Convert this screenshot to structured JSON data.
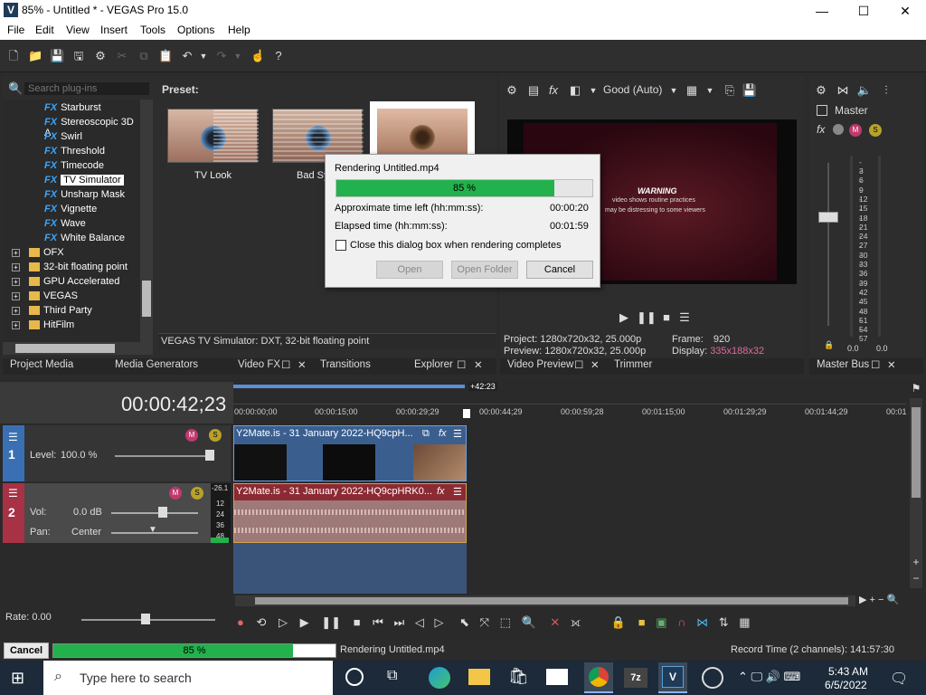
{
  "window": {
    "title": "85% - Untitled * - VEGAS Pro 15.0",
    "logo": "V",
    "min": "—",
    "max": "☐",
    "close": "✕"
  },
  "menu": [
    "File",
    "Edit",
    "View",
    "Insert",
    "Tools",
    "Options",
    "Help"
  ],
  "plugins": {
    "search_placeholder": "Search plug-ins",
    "fx_prefix": "FX",
    "fx_items": [
      "Starburst",
      "Stereoscopic 3D A",
      "Swirl",
      "Threshold",
      "Timecode",
      "TV Simulator",
      "Unsharp Mask",
      "Vignette",
      "Wave",
      "White Balance"
    ],
    "folders": [
      "OFX",
      "32-bit floating point",
      "GPU Accelerated",
      "VEGAS",
      "Third Party",
      "HitFilm"
    ],
    "preset_label": "Preset:",
    "presets": [
      "TV Look",
      "Bad Sy"
    ],
    "status": "VEGAS TV Simulator: DXT, 32-bit floating point"
  },
  "tabs_left": [
    "Project Media",
    "Media Generators",
    "Video FX",
    "Transitions",
    "Explorer"
  ],
  "preview": {
    "quality": "Good (Auto)",
    "warning_title": "WARNING",
    "warning_line1": "video shows routine practices",
    "warning_line2": "may be distressing to some viewers",
    "project_label": "Project:",
    "project_value": "1280x720x32, 25.000p",
    "frame_label": "Frame:",
    "frame_value": "920",
    "preview_label": "Preview:",
    "preview_value": "1280x720x32, 25.000p",
    "display_label": "Display:",
    "display_value": "335x188x32",
    "tabs": [
      "Video Preview",
      "Trimmer"
    ]
  },
  "master": {
    "label": "Master",
    "db_scale": [
      "3",
      "6",
      "9",
      "12",
      "15",
      "18",
      "21",
      "24",
      "27",
      "30",
      "33",
      "36",
      "39",
      "42",
      "45",
      "48",
      "51",
      "54",
      "57"
    ],
    "left_val": "0.0",
    "right_val": "0.0",
    "tab": "Master Bus"
  },
  "dialog": {
    "title": "Rendering Untitled.mp4",
    "progress_text": "85 %",
    "progress": 0.85,
    "time_left_label": "Approximate time left (hh:mm:ss):",
    "time_left_value": "00:00:20",
    "elapsed_label": "Elapsed time (hh:mm:ss):",
    "elapsed_value": "00:01:59",
    "checkbox_label": "Close this dialog box when rendering completes",
    "open": "Open",
    "open_folder": "Open Folder",
    "cancel": "Cancel"
  },
  "timeline": {
    "timecode": "00:00:42;23",
    "marker": "+42:23",
    "ruler": [
      "00:00:00;00",
      "00:00:15;00",
      "00:00:29;29",
      "00:00:44;29",
      "00:00:59;28",
      "00:01:15;00",
      "00:01:29;29",
      "00:01:44;29",
      "00:01"
    ],
    "track1": {
      "num": "1",
      "level_label": "Level:",
      "level_value": "100.0 %",
      "clip": "Y2Mate.is - 31 January 2022-HQ9cpH..."
    },
    "track2": {
      "num": "2",
      "vol_label": "Vol:",
      "vol_value": "0.0 dB",
      "pan_label": "Pan:",
      "pan_value": "Center",
      "clip": "Y2Mate.is - 31 January 2022-HQ9cpHRK0...",
      "meter_top": "-26.1",
      "meter": [
        "12",
        "24",
        "36",
        "48"
      ]
    },
    "rate": "Rate: 0.00"
  },
  "statusbar": {
    "cancel": "Cancel",
    "progress_text": "85 %",
    "progress": 0.85,
    "rendering": "Rendering Untitled.mp4",
    "record_time": "Record Time (2 channels): 141:57:30"
  },
  "taskbar": {
    "search_placeholder": "Type here to search",
    "time": "5:43 AM",
    "date": "6/5/2022"
  },
  "colors": {
    "accent_green": "#22b14c",
    "clip_video": "#3a5f8f",
    "clip_audio": "#8c2a33",
    "track_video": "#3b6fb3",
    "track_audio": "#a83245"
  }
}
